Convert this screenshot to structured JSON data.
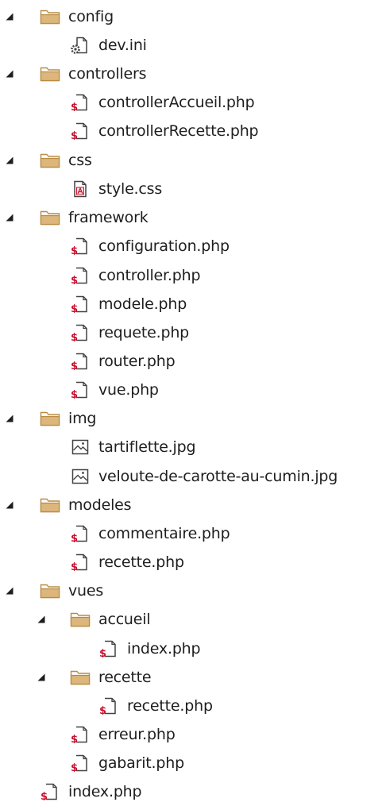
{
  "tree": {
    "nodes": [
      {
        "label": "config",
        "type": "folder",
        "expanded": true,
        "icon": "folder-icon"
      },
      {
        "label": "dev.ini",
        "type": "file",
        "icon": "config-file-icon"
      },
      {
        "label": "controllers",
        "type": "folder",
        "expanded": true,
        "icon": "folder-icon"
      },
      {
        "label": "controllerAccueil.php",
        "type": "file",
        "icon": "php-file-icon"
      },
      {
        "label": "controllerRecette.php",
        "type": "file",
        "icon": "php-file-icon"
      },
      {
        "label": "css",
        "type": "folder",
        "expanded": true,
        "icon": "folder-icon"
      },
      {
        "label": "style.css",
        "type": "file",
        "icon": "css-file-icon"
      },
      {
        "label": "framework",
        "type": "folder",
        "expanded": true,
        "icon": "folder-icon"
      },
      {
        "label": "configuration.php",
        "type": "file",
        "icon": "php-file-icon"
      },
      {
        "label": "controller.php",
        "type": "file",
        "icon": "php-file-icon"
      },
      {
        "label": "modele.php",
        "type": "file",
        "icon": "php-file-icon"
      },
      {
        "label": "requete.php",
        "type": "file",
        "icon": "php-file-icon"
      },
      {
        "label": "router.php",
        "type": "file",
        "icon": "php-file-icon"
      },
      {
        "label": "vue.php",
        "type": "file",
        "icon": "php-file-icon"
      },
      {
        "label": "img",
        "type": "folder",
        "expanded": true,
        "icon": "folder-icon"
      },
      {
        "label": "tartiflette.jpg",
        "type": "file",
        "icon": "image-file-icon"
      },
      {
        "label": "veloute-de-carotte-au-cumin.jpg",
        "type": "file",
        "icon": "image-file-icon"
      },
      {
        "label": "modeles",
        "type": "folder",
        "expanded": true,
        "icon": "folder-icon"
      },
      {
        "label": "commentaire.php",
        "type": "file",
        "icon": "php-file-icon"
      },
      {
        "label": "recette.php",
        "type": "file",
        "icon": "php-file-icon"
      },
      {
        "label": "vues",
        "type": "folder",
        "expanded": true,
        "icon": "folder-icon"
      },
      {
        "label": "accueil",
        "type": "folder",
        "expanded": true,
        "icon": "folder-icon"
      },
      {
        "label": "index.php",
        "type": "file",
        "icon": "php-file-icon"
      },
      {
        "label": "recette",
        "type": "folder",
        "expanded": true,
        "icon": "folder-icon"
      },
      {
        "label": "recette.php",
        "type": "file",
        "icon": "php-file-icon"
      },
      {
        "label": "erreur.php",
        "type": "file",
        "icon": "php-file-icon"
      },
      {
        "label": "gabarit.php",
        "type": "file",
        "icon": "php-file-icon"
      },
      {
        "label": "index.php",
        "type": "file",
        "icon": "php-file-icon"
      }
    ]
  },
  "colors": {
    "folder_fill": "#dcb67a",
    "folder_stroke": "#b88c45",
    "php_accent": "#c8102e",
    "text": "#1e1e1e",
    "expander": "#1e1e1e"
  }
}
